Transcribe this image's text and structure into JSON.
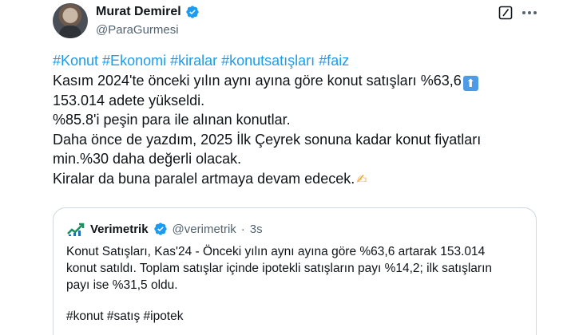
{
  "author": {
    "display_name": "Murat Demirel",
    "handle": "@ParaGurmesi"
  },
  "icons": {
    "verified": "verified-badge-icon",
    "edit": "edit-icon",
    "more": "more-options-icon"
  },
  "tweet": {
    "hashtags": "#Konut #Ekonomi #kiralar #konutsatışları #faiz",
    "line1": "Kasım 2024'te önceki yılın aynı ayına göre konut satışları %63,6",
    "line2": "153.014 adete yükseldi.",
    "line3": "%85.8'i peşin para ile alınan konutlar.",
    "line4": "Daha önce de yazdım, 2025 İlk Çeyrek sonuna kadar konut fiyatları",
    "line5": "min.%30 daha değerli olacak.",
    "line6": "Kiralar da buna paralel artmaya devam edecek."
  },
  "quoted": {
    "display_name": "Verimetrik",
    "handle": "@verimetrik",
    "separator": "·",
    "time": "3s",
    "text_line1": "Konut Satışları, Kas'24 - Önceki yılın aynı ayına göre %63,6 artarak 153.014",
    "text_line2": "konut satıldı. Toplam satışlar içinde ipotekli satışların payı %14,2; ilk satışların",
    "text_line3": "payı ise %31,5 oldu.",
    "tags": "#konut #satış #ipotek"
  },
  "colors": {
    "accent": "#1d9bf0",
    "text": "#0f1419",
    "muted": "#536471",
    "border": "#cfd9de"
  }
}
